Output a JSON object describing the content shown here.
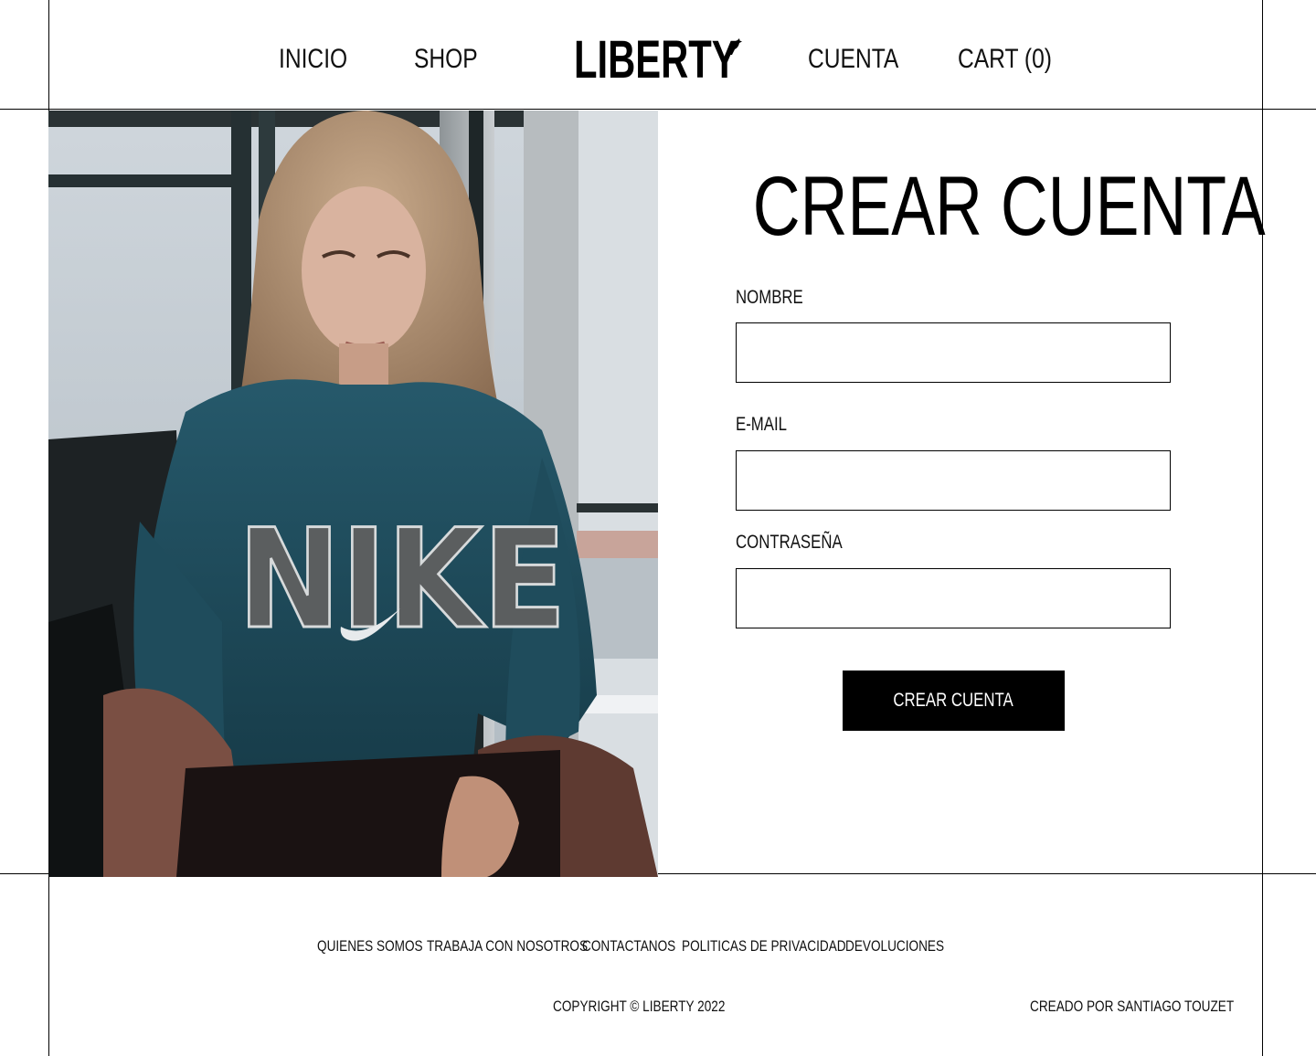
{
  "header": {
    "nav_left": [
      {
        "label": "INICIO"
      },
      {
        "label": "SHOP"
      }
    ],
    "logo_text": "LIBERTY",
    "nav_right": [
      {
        "label": "CUENTA"
      },
      {
        "label": "CART (0)"
      }
    ]
  },
  "hero_image": {
    "description_icon": "photo-woman-hoodie",
    "hoodie_print": "NIKE"
  },
  "form": {
    "title": "CREAR CUENTA",
    "fields": [
      {
        "label": "NOMBRE",
        "value": "",
        "placeholder": ""
      },
      {
        "label": "E-MAIL",
        "value": "",
        "placeholder": ""
      },
      {
        "label": "CONTRASEÑA",
        "value": "",
        "placeholder": ""
      }
    ],
    "submit_label": "CREAR CUENTA"
  },
  "footer": {
    "links": [
      {
        "label": "QUIENES SOMOS"
      },
      {
        "label": "TRABAJA CON NOSOTROS"
      },
      {
        "label": "CONTACTANOS"
      },
      {
        "label": "POLITICAS DE PRIVACIDAD"
      },
      {
        "label": "DEVOLUCIONES"
      }
    ],
    "copyright": "COPYRIGHT © LIBERTY 2022",
    "credit": "CREADO POR SANTIAGO TOUZET"
  },
  "colors": {
    "background": "#ffffff",
    "text": "#000000",
    "button_bg": "#000000",
    "button_text": "#ffffff",
    "hoodie": "#1f5466"
  }
}
